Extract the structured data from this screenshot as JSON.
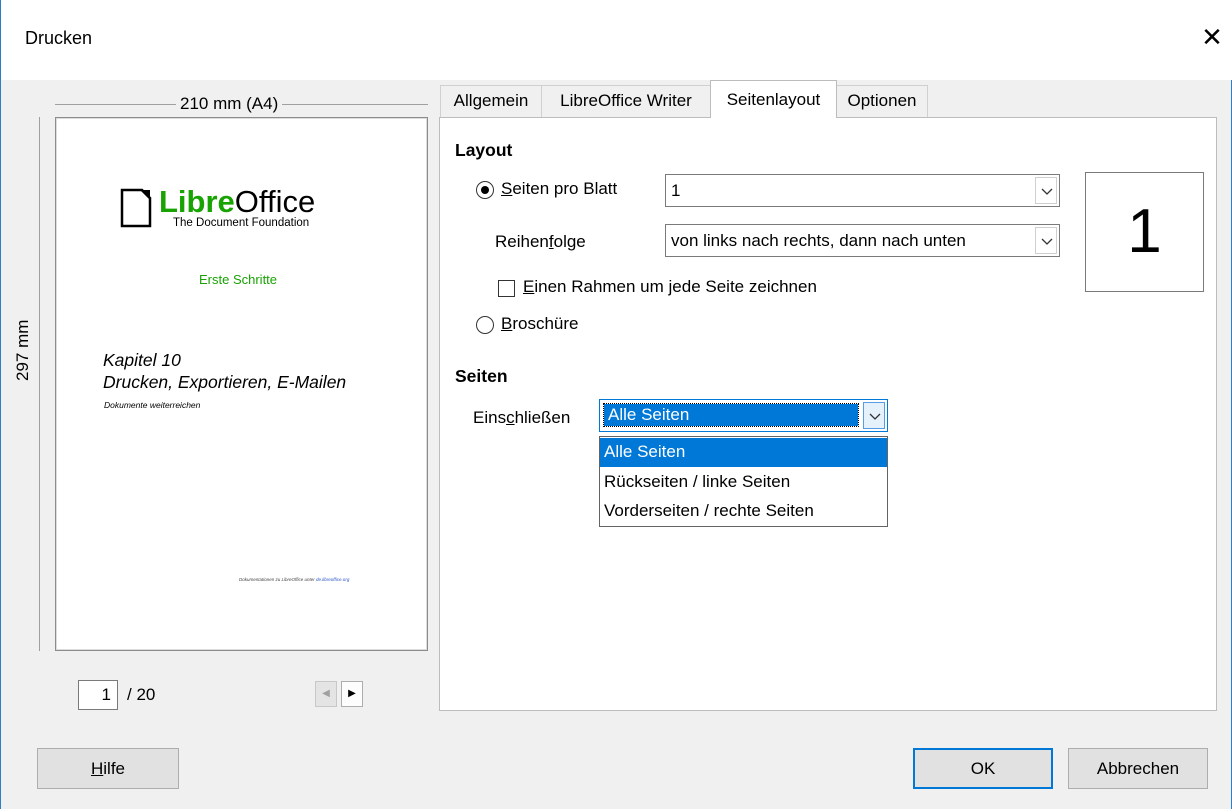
{
  "window": {
    "title": "Drucken"
  },
  "preview": {
    "width_label": "210 mm (A4)",
    "height_label": "297 mm",
    "page_current": "1",
    "page_total": "/ 20",
    "doc": {
      "logo_libre": "Libre",
      "logo_office": "Office",
      "logo_subtitle": "The Document Foundation",
      "subtitle": "Erste Schritte",
      "chapter": "Kapitel 10",
      "heading": "Drucken, Exportieren, E-Mailen",
      "tagline": "Dokumente weiterreichen",
      "footer_text": "Dokumentationen zu LibreOffice unter ",
      "footer_link": "de.libreoffice.org"
    }
  },
  "tabs": [
    {
      "label": "Allgemein",
      "active": false
    },
    {
      "label": "LibreOffice Writer",
      "active": false
    },
    {
      "label": "Seitenlayout",
      "active": true
    },
    {
      "label": "Optionen",
      "active": false
    }
  ],
  "layout": {
    "title": "Layout",
    "pages_per_sheet_label_u": "S",
    "pages_per_sheet_label_rest": "eiten pro Blatt",
    "pages_per_sheet_value": "1",
    "order_label_a": "Reihen",
    "order_label_u": "f",
    "order_label_b": "olge",
    "order_value": "von links nach rechts, dann nach unten",
    "frame_label_u": "E",
    "frame_label_rest": "inen Rahmen um jede Seite zeichnen",
    "frame_checked": false,
    "brochure_label_u": "B",
    "brochure_label_rest": "roschüre",
    "preview_number": "1"
  },
  "pages": {
    "title": "Seiten",
    "include_label_a": "Eins",
    "include_label_u": "c",
    "include_label_b": "hließen",
    "include_value": "Alle Seiten",
    "options": [
      "Alle Seiten",
      "Rückseiten / linke Seiten",
      "Vorderseiten / rechte Seiten"
    ]
  },
  "buttons": {
    "help_u": "H",
    "help_rest": "ilfe",
    "ok": "OK",
    "cancel": "Abbrechen"
  }
}
